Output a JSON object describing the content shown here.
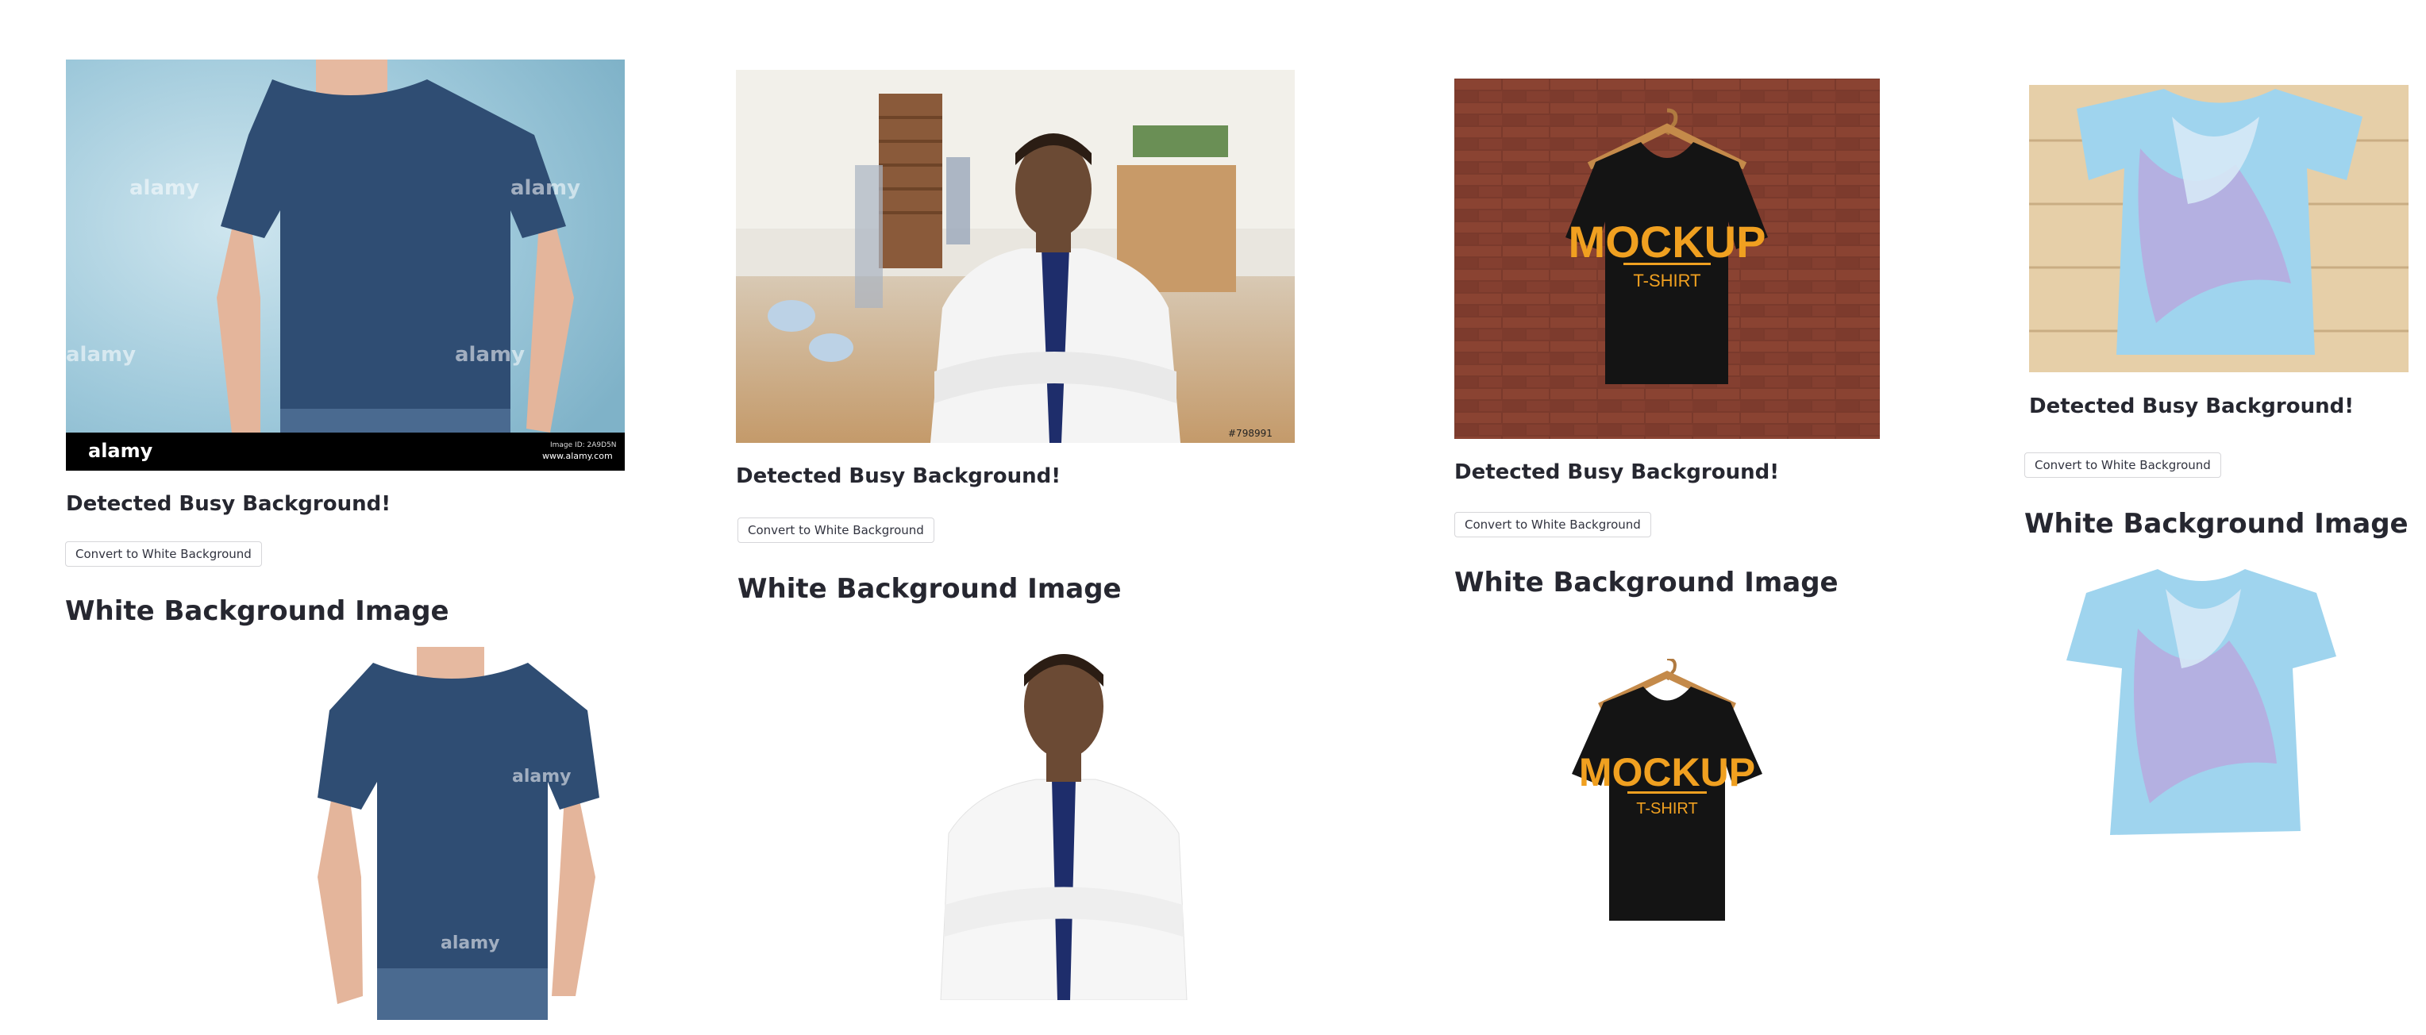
{
  "cards": [
    {
      "detected_text": "Detected Busy Background!",
      "button_label": "Convert to White Background",
      "result_heading": "White Background Image",
      "photo_watermark": "alamy",
      "photo_footer_brand": "alamy",
      "photo_footer_url": "www.alamy.com",
      "photo_footer_id": "Image ID: 2A9D5N"
    },
    {
      "detected_text": "Detected Busy Background!",
      "button_label": "Convert to White Background",
      "result_heading": "White Background Image",
      "photo_tag": "#798991"
    },
    {
      "detected_text": "Detected Busy Background!",
      "button_label": "Convert to White Background",
      "result_heading": "White Background Image",
      "shirt_print_main": "MOCKUP",
      "shirt_print_sub": "T-SHIRT"
    },
    {
      "detected_text": "Detected Busy Background!",
      "button_label": "Convert to White Background",
      "result_heading": "White Background Image"
    }
  ],
  "colors": {
    "navy_shirt": "#2f4d73",
    "brick": "#7a3a2c",
    "mockup_orange": "#f0a020",
    "tie_dye_blue": "#9fd4ee",
    "tie_dye_purple": "#b9a6dd"
  }
}
